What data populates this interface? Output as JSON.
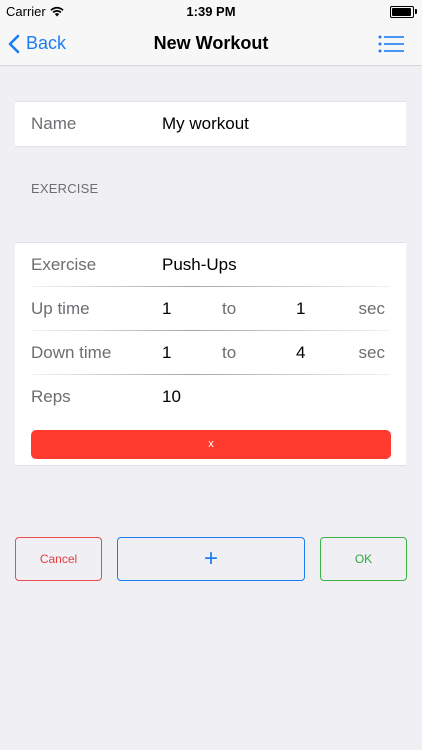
{
  "status": {
    "carrier": "Carrier",
    "time": "1:39 PM"
  },
  "nav": {
    "back_label": "Back",
    "title": "New Workout"
  },
  "name_row": {
    "label": "Name",
    "value": "My workout"
  },
  "exercise_section": {
    "header": "EXERCISE"
  },
  "exercise": {
    "exercise_label": "Exercise",
    "exercise_value": "Push-Ups",
    "up_label": "Up time",
    "up_from": "1",
    "up_to_word": "to",
    "up_to": "1",
    "up_unit": "sec",
    "down_label": "Down time",
    "down_from": "1",
    "down_to_word": "to",
    "down_to": "4",
    "down_unit": "sec",
    "reps_label": "Reps",
    "reps_value": "10",
    "remove_label": "x"
  },
  "buttons": {
    "cancel": "Cancel",
    "add": "+",
    "ok": "OK"
  },
  "colors": {
    "accent": "#1a7ef2",
    "danger": "#ff3b30",
    "success": "#3cb34a"
  }
}
